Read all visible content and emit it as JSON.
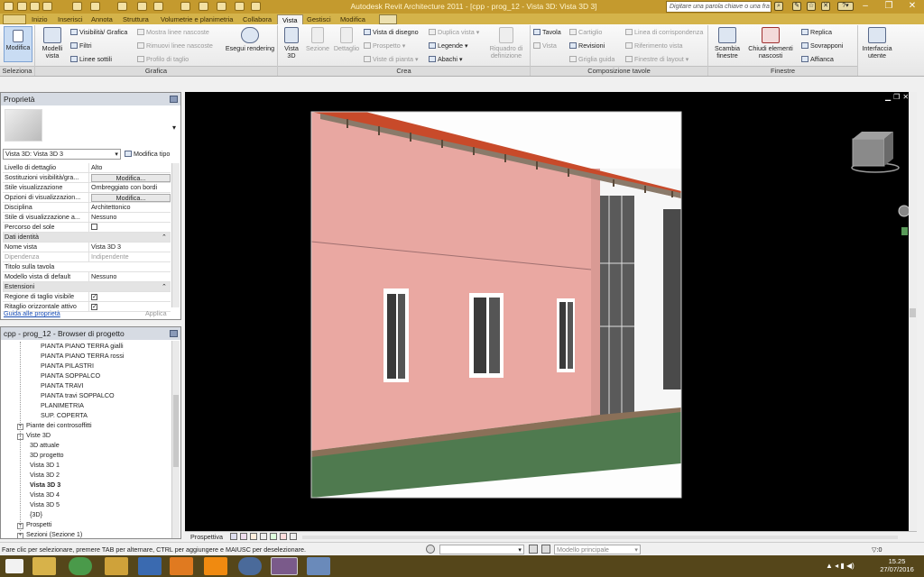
{
  "app": {
    "title": "Autodesk Revit Architecture 2011 - [cpp - prog_12 - Vista 3D: Vista 3D 3]",
    "search_placeholder": "Digitare una parola chiave o una fra"
  },
  "ribbon_tabs": [
    "Inizio",
    "Inserisci",
    "Annota",
    "Struttura",
    "Volumetrie e planimetria",
    "Collabora",
    "Vista",
    "Gestisci",
    "Modifica"
  ],
  "active_tab": "Vista",
  "ribbon": {
    "seleziona": {
      "modifica": "Modifica",
      "panel": "Seleziona"
    },
    "grafica": {
      "modelli_vista": "Modelli vista",
      "visibilita": "Visibilità/ Grafica",
      "filtri": "Filtri",
      "linee_sottili": "Linee sottili",
      "mostra_linee": "Mostra linee nascoste",
      "rimuovi_linee": "Rimuovi linee nascoste",
      "profilo_taglio": "Profilo di taglio",
      "esegui_rendering": "Esegui rendering",
      "panel": "Grafica"
    },
    "crea": {
      "vista_3d": "Vista 3D",
      "sezione": "Sezione",
      "dettaglio": "Dettaglio",
      "vista_disegno": "Vista di disegno",
      "prospetto": "Prospetto",
      "viste_pianta": "Viste di pianta",
      "duplica_vista": "Duplica vista",
      "legende": "Legende",
      "abachi": "Abachi",
      "riquadro": "Riquadro di definizione",
      "panel": "Crea"
    },
    "composizione": {
      "tavola": "Tavola",
      "vista": "Vista",
      "cartiglio": "Cartiglio",
      "revisioni": "Revisioni",
      "griglia_guida": "Griglia guida",
      "linea_corrispondenza": "Linea di corrispondenza",
      "riferimento_vista": "Riferimento vista",
      "finestre_layout": "Finestre di layout",
      "panel": "Composizione tavole"
    },
    "finestre": {
      "scambia": "Scambia finestre",
      "chiudi": "Chiudi elementi nascosti",
      "replica": "Replica",
      "sovrapponi": "Sovrapponi",
      "affianca": "Affianca",
      "interfaccia": "Interfaccia utente",
      "panel": "Finestre"
    }
  },
  "properties": {
    "title": "Proprietà",
    "type_selector": "Vista 3D: Vista 3D 3",
    "modifica_tipo": "Modifica tipo",
    "rows": [
      {
        "k": "Livello di dettaglio",
        "v": "Alto"
      },
      {
        "k": "Sostituzioni visibilità/gra...",
        "v": "Modifica...",
        "btn": true
      },
      {
        "k": "Stile visualizzazione",
        "v": "Ombreggiato con bordi"
      },
      {
        "k": "Opzioni di visualizzazion...",
        "v": "Modifica...",
        "btn": true
      },
      {
        "k": "Disciplina",
        "v": "Architettonico"
      },
      {
        "k": "Stile di visualizzazione a...",
        "v": "Nessuno"
      },
      {
        "k": "Percorso del sole",
        "v": "",
        "check": "off"
      },
      {
        "k": "Dati identità",
        "v": "",
        "group": true
      },
      {
        "k": "Nome vista",
        "v": "Vista 3D 3"
      },
      {
        "k": "Dipendenza",
        "v": "Indipendente",
        "dim": true
      },
      {
        "k": "Titolo sulla tavola",
        "v": ""
      },
      {
        "k": "Modello vista di default",
        "v": "Nessuno"
      },
      {
        "k": "Estensioni",
        "v": "",
        "group": true
      },
      {
        "k": "Regione di taglio visibile",
        "v": "",
        "check": "on"
      },
      {
        "k": "Ritaglio orizzontale attivo",
        "v": "",
        "check": "on"
      }
    ],
    "help_link": "Guida alle proprietà",
    "apply": "Applica"
  },
  "browser": {
    "title": "cpp - prog_12 - Browser di progetto",
    "items": [
      {
        "label": "PIANTA PIANO TERRA gialli",
        "lvl": 3
      },
      {
        "label": "PIANTA PIANO TERRA rossi",
        "lvl": 3
      },
      {
        "label": "PIANTA PILASTRI",
        "lvl": 3
      },
      {
        "label": "PIANTA SOPPALCO",
        "lvl": 3
      },
      {
        "label": "PIANTA TRAVI",
        "lvl": 3
      },
      {
        "label": "PIANTA travi SOPPALCO",
        "lvl": 3
      },
      {
        "label": "PLANIMETRIA",
        "lvl": 3
      },
      {
        "label": "SUP. COPERTA",
        "lvl": 3
      },
      {
        "label": "Piante dei controsoffitti",
        "lvl": 1,
        "tog": "+"
      },
      {
        "label": "Viste 3D",
        "lvl": 1,
        "tog": "-"
      },
      {
        "label": "3D attuale",
        "lvl": 2
      },
      {
        "label": "3D progetto",
        "lvl": 2
      },
      {
        "label": "Vista 3D 1",
        "lvl": 2
      },
      {
        "label": "Vista 3D 2",
        "lvl": 2
      },
      {
        "label": "Vista 3D 3",
        "lvl": 2,
        "bold": true
      },
      {
        "label": "Vista 3D 4",
        "lvl": 2
      },
      {
        "label": "Vista 3D 5",
        "lvl": 2
      },
      {
        "label": "{3D}",
        "lvl": 2
      },
      {
        "label": "Prospetti",
        "lvl": 1,
        "tog": "+"
      },
      {
        "label": "Sezioni (Sezione 1)",
        "lvl": 1,
        "tog": "+"
      }
    ]
  },
  "view": {
    "projection": "Prospettiva"
  },
  "status": {
    "message": "Fare clic per selezionare, premere TAB per alternare, CTRL per aggiungere e MAIUSC per deselezionare.",
    "model": "Modello principale",
    "filter": ":0"
  },
  "taskbar": {
    "time": "15.25",
    "date": "27/07/2016"
  },
  "colors": {
    "titlebar": "#c49a2e",
    "wall": "#e9a6a0",
    "roof": "#c84a2a",
    "ground": "#4f7a4f"
  }
}
